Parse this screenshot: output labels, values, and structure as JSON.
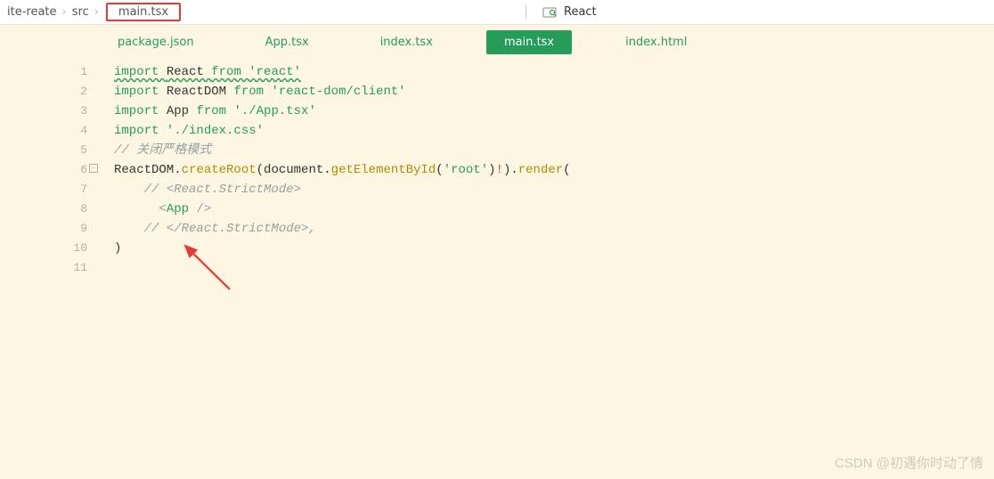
{
  "breadcrumb": {
    "parent1": "ite-reate",
    "parent2": "src",
    "current": "main.tsx"
  },
  "header": {
    "preview_label": "React"
  },
  "tabs": [
    {
      "label": "package.json",
      "active": false
    },
    {
      "label": "App.tsx",
      "active": false
    },
    {
      "label": "index.tsx",
      "active": false
    },
    {
      "label": "main.tsx",
      "active": true
    },
    {
      "label": "index.html",
      "active": false
    }
  ],
  "code": {
    "lines": [
      {
        "n": 1,
        "tokens": [
          {
            "t": "import ",
            "c": "kw",
            "sq": true
          },
          {
            "t": "React ",
            "c": "id",
            "sq": true
          },
          {
            "t": "from ",
            "c": "kw",
            "sq": true
          },
          {
            "t": "'react'",
            "c": "str",
            "sq": true
          }
        ]
      },
      {
        "n": 2,
        "tokens": [
          {
            "t": "import ",
            "c": "kw"
          },
          {
            "t": "ReactDOM ",
            "c": "id"
          },
          {
            "t": "from ",
            "c": "kw"
          },
          {
            "t": "'react-dom/client'",
            "c": "str"
          }
        ]
      },
      {
        "n": 3,
        "tokens": [
          {
            "t": "import ",
            "c": "kw"
          },
          {
            "t": "App ",
            "c": "id"
          },
          {
            "t": "from ",
            "c": "kw"
          },
          {
            "t": "'./App.tsx'",
            "c": "str"
          }
        ]
      },
      {
        "n": 4,
        "tokens": [
          {
            "t": "import ",
            "c": "kw"
          },
          {
            "t": "'./index.css'",
            "c": "str"
          }
        ]
      },
      {
        "n": 5,
        "tokens": [
          {
            "t": "// 关闭严格模式",
            "c": "comment"
          }
        ]
      },
      {
        "n": 6,
        "fold": true,
        "tokens": [
          {
            "t": "ReactDOM",
            "c": "id"
          },
          {
            "t": ".",
            "c": "dot"
          },
          {
            "t": "createRoot",
            "c": "func"
          },
          {
            "t": "(",
            "c": "punct"
          },
          {
            "t": "document",
            "c": "id"
          },
          {
            "t": ".",
            "c": "dot"
          },
          {
            "t": "getElementById",
            "c": "func"
          },
          {
            "t": "(",
            "c": "punct"
          },
          {
            "t": "'root'",
            "c": "str"
          },
          {
            "t": ")",
            "c": "punct"
          },
          {
            "t": "!",
            "c": "op"
          },
          {
            "t": ")",
            "c": "punct"
          },
          {
            "t": ".",
            "c": "dot"
          },
          {
            "t": "render",
            "c": "func"
          },
          {
            "t": "(",
            "c": "punct"
          }
        ]
      },
      {
        "n": 7,
        "indent": 2,
        "tokens": [
          {
            "t": "// <React.StrictMode>",
            "c": "comment"
          }
        ]
      },
      {
        "n": 8,
        "indent": 2,
        "tokens": [
          {
            "t": "  ",
            "c": "punct"
          },
          {
            "t": "<",
            "c": "tag-angle"
          },
          {
            "t": "App",
            "c": "tag-name"
          },
          {
            "t": " />",
            "c": "tag-angle"
          }
        ]
      },
      {
        "n": 9,
        "indent": 2,
        "tokens": [
          {
            "t": "// </React.StrictMode>,",
            "c": "comment"
          }
        ]
      },
      {
        "n": 10,
        "tokens": [
          {
            "t": ")",
            "c": "punct"
          }
        ]
      },
      {
        "n": 11,
        "tokens": []
      }
    ]
  },
  "fold_glyph": "⊟",
  "bracket_glyph": "└",
  "watermark": "CSDN @初遇你时动了情"
}
